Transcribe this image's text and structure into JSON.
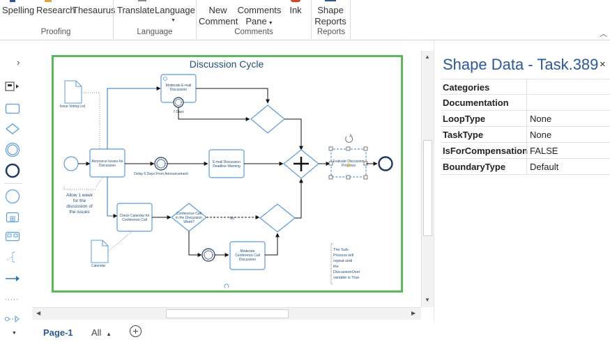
{
  "ribbon": {
    "buttons": {
      "spelling": "Spelling",
      "research": "Research",
      "thesaurus": "Thesaurus",
      "translate": "Translate",
      "language": "Language",
      "new_comment_1": "New",
      "new_comment_2": "Comment",
      "comments_pane_1": "Comments",
      "comments_pane_2": "Pane",
      "ink": "Ink",
      "shape_reports_1": "Shape",
      "shape_reports_2": "Reports"
    },
    "groups": {
      "proofing": "Proofing",
      "language": "Language",
      "comments": "Comments",
      "reports": "Reports"
    }
  },
  "diagram": {
    "title": "Discussion Cycle",
    "issue_voting_list": "Issue Voting List",
    "moderate_email_1": "Moderate E-mail",
    "moderate_email_2": "Discussion",
    "seven_days": "7 Days",
    "announce_1": "Announce Issues for",
    "announce_2": "Discussion",
    "delay": "Delay 6 Days From Announcement",
    "email_deadline_1": "E-mail Discussion",
    "email_deadline_2": "Deadline Warning",
    "evaluate_1": "Evaluate Discussion",
    "evaluate_2": "Progress",
    "allow_1": "Allow 1 week",
    "allow_2": "for the",
    "allow_3": "discussion of",
    "allow_4": "the issues",
    "check_cal_1": "Check Calendar for",
    "check_cal_2": "Conference Call",
    "conf_q_1": "Conference Call",
    "conf_q_2": "in the Discussion",
    "conf_q_3": "Week?",
    "no_label": "No",
    "calendar": "Calendar",
    "moderate_conf_1": "Moderate",
    "moderate_conf_2": "Conference Call",
    "moderate_conf_3": "Discussion",
    "note_1": "The Sub-",
    "note_2": "Process will",
    "note_3": "repeat until",
    "note_4": "the",
    "note_5": "DiscussionOver",
    "note_6": "variable is True"
  },
  "shape_data": {
    "title": "Shape Data - Task.389",
    "close": "×",
    "rows": [
      {
        "key": "Categories",
        "value": ""
      },
      {
        "key": "Documentation",
        "value": ""
      },
      {
        "key": "LoopType",
        "value": "None"
      },
      {
        "key": "TaskType",
        "value": "None"
      },
      {
        "key": "IsForCompensation",
        "value": "FALSE"
      },
      {
        "key": "BoundaryType",
        "value": "Default"
      }
    ]
  },
  "tabs": {
    "page1": "Page-1",
    "all": "All",
    "add": "+"
  },
  "colors": {
    "accent": "#2b579a",
    "page_border": "#5cb85c",
    "shape_stroke": "#5b9bd5",
    "title_blue": "#1f4e79"
  }
}
